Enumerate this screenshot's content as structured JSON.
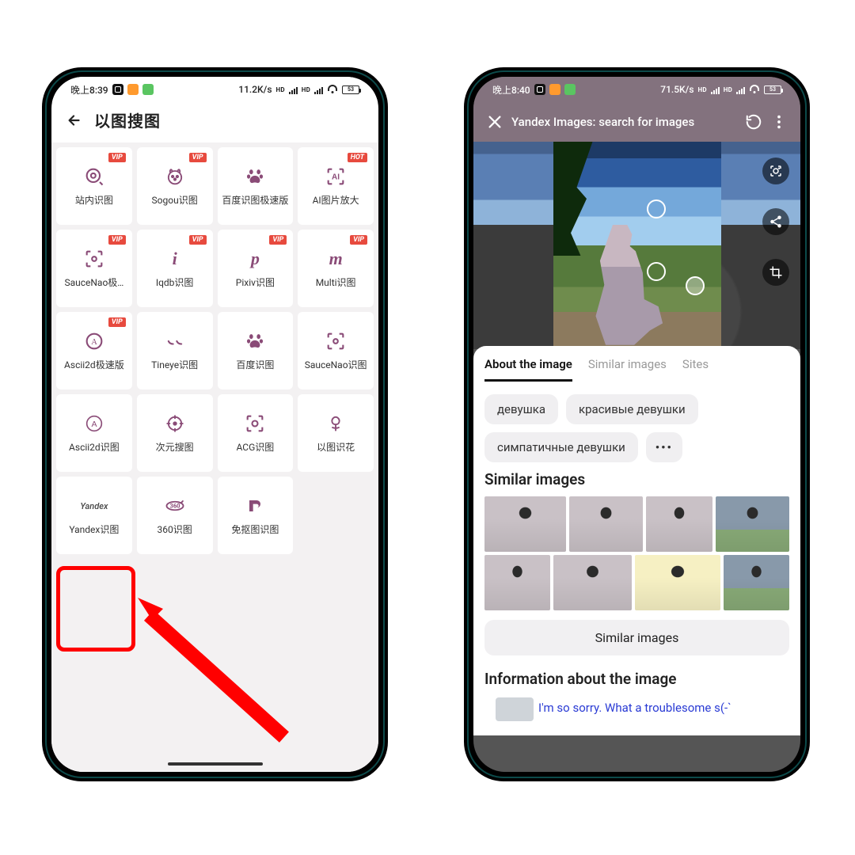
{
  "left": {
    "status": {
      "time": "晚上8:39",
      "net": "11.2K/s",
      "battery": "53"
    },
    "page_title": "以图搜图",
    "items": [
      {
        "label": "站内识图",
        "icon": "target",
        "badge": "VIP"
      },
      {
        "label": "Sogou识图",
        "icon": "dog",
        "badge": "VIP"
      },
      {
        "label": "百度识图极速版",
        "icon": "paw",
        "badge": ""
      },
      {
        "label": "AI图片放大",
        "icon": "ai-scan",
        "badge": "HOT"
      },
      {
        "label": "SauceNao极…",
        "icon": "scan",
        "badge": "VIP"
      },
      {
        "label": "Iqdb识图",
        "icon": "letter-i",
        "badge": "VIP"
      },
      {
        "label": "Pixiv识图",
        "icon": "letter-p",
        "badge": "VIP"
      },
      {
        "label": "Multi识图",
        "icon": "letter-m",
        "badge": "VIP"
      },
      {
        "label": "Ascii2d极速版",
        "icon": "circle-a",
        "badge": "VIP"
      },
      {
        "label": "Tineye识图",
        "icon": "smirk",
        "badge": ""
      },
      {
        "label": "百度识图",
        "icon": "paw",
        "badge": ""
      },
      {
        "label": "SauceNao识图",
        "icon": "scan",
        "badge": ""
      },
      {
        "label": "Ascii2d识图",
        "icon": "circle-a2",
        "badge": ""
      },
      {
        "label": "次元搜图",
        "icon": "crosshair",
        "badge": ""
      },
      {
        "label": "ACG识图",
        "icon": "focus",
        "badge": ""
      },
      {
        "label": "以图识花",
        "icon": "flower",
        "badge": ""
      },
      {
        "label": "Yandex识图",
        "icon": "yandex",
        "badge": ""
      },
      {
        "label": "360识图",
        "icon": "360",
        "badge": ""
      },
      {
        "label": "免抠图识图",
        "icon": "cutout",
        "badge": ""
      }
    ],
    "highlight_index": 16,
    "arrow_target_index": 16
  },
  "right": {
    "status": {
      "time": "晚上8:40",
      "net": "71.5K/s",
      "battery": "53"
    },
    "header_title": "Yandex Images: search for images",
    "tabs": [
      {
        "label": "About the image",
        "active": true
      },
      {
        "label": "Similar images",
        "active": false
      },
      {
        "label": "Sites",
        "active": false
      }
    ],
    "chips": [
      "девушка",
      "красивые девушки",
      "симпатичные девушки"
    ],
    "chips_more": "•••",
    "section_similar_title": "Similar images",
    "similar_button": "Similar images",
    "section_info_title": "Information about the image",
    "info_line": "I'm so sorry. What a troublesome s(-`",
    "tools": [
      "lens-icon",
      "share-icon",
      "crop-icon"
    ]
  }
}
